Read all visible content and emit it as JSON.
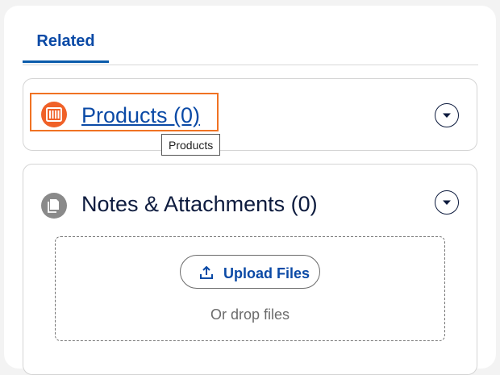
{
  "tabs": {
    "related": "Related"
  },
  "products": {
    "title": "Products (0)",
    "tooltip": "Products",
    "icon": "products-icon"
  },
  "notes": {
    "title": "Notes & Attachments (0)",
    "icon": "notes-icon",
    "upload_label": "Upload Files",
    "drop_text": "Or drop files"
  },
  "colors": {
    "accent": "#0b4aa6",
    "products_icon": "#f06128",
    "highlight": "#f07223",
    "notes_icon": "#8a8a8a"
  }
}
